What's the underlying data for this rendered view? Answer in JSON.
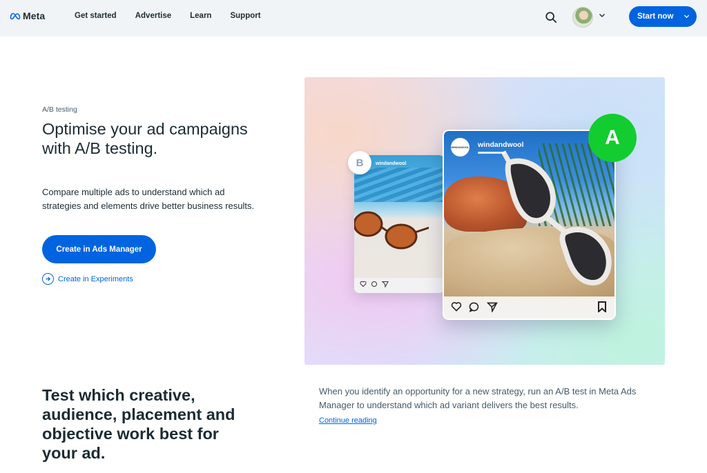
{
  "nav": {
    "brand": "Meta",
    "links": [
      "Get started",
      "Advertise",
      "Learn",
      "Support"
    ],
    "cta": "Start now"
  },
  "hero": {
    "eyebrow": "A/B testing",
    "title": "Optimise your ad campaigns with A/B testing.",
    "description": "Compare multiple ads to understand which ad strategies and elements drive better business results.",
    "primary_button": "Create in Ads Manager",
    "secondary_link": "Create in Experiments"
  },
  "illustration": {
    "variant_a_badge": "A",
    "variant_b_badge": "B",
    "account_name": "windandwool",
    "account_logo_text": "WIND&WOOL"
  },
  "lower": {
    "title": "Test which creative, audience, placement and objective work best for your ad.",
    "description": "When you identify an opportunity for a new strategy, run an A/B test in Meta Ads Manager to understand which ad variant delivers the best results.",
    "link": "Continue reading"
  },
  "colors": {
    "accent": "#0064e0",
    "badge_a": "#12cc30",
    "text": "#1c2b33",
    "nav_bg": "#f1f4f7"
  },
  "icons": [
    "meta-logo-icon",
    "search-icon",
    "chevron-down-icon",
    "arrow-right-circle-icon",
    "heart-icon",
    "comment-icon",
    "share-icon",
    "bookmark-icon"
  ]
}
